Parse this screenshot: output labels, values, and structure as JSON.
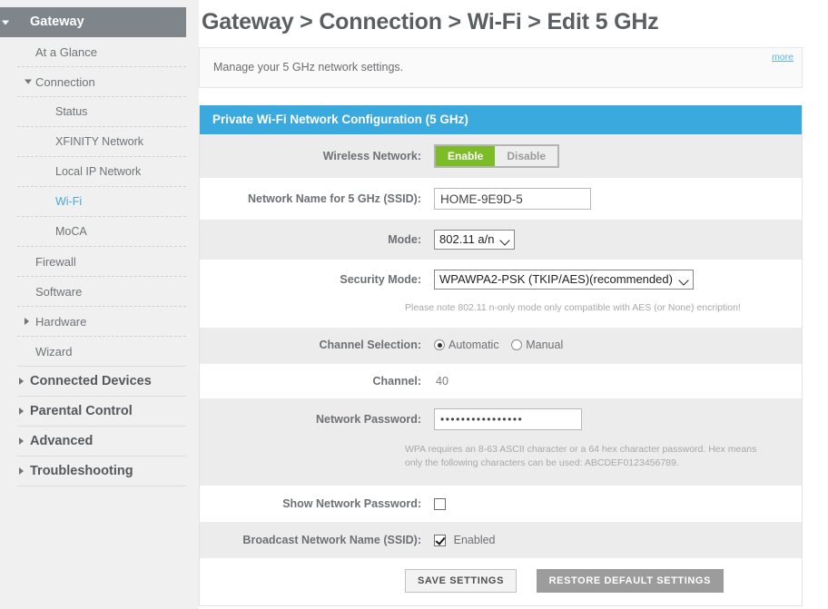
{
  "sidebar": {
    "items": [
      {
        "label": "Gateway",
        "level": "header",
        "caret": "down",
        "active": true
      },
      {
        "label": "At a Glance",
        "level": "lvl1",
        "caret": "none",
        "active": false
      },
      {
        "label": "Connection",
        "level": "lvl1",
        "caret": "down",
        "active": false
      },
      {
        "label": "Status",
        "level": "lvl2",
        "caret": "none",
        "active": false
      },
      {
        "label": "XFINITY Network",
        "level": "lvl2",
        "caret": "none",
        "active": false
      },
      {
        "label": "Local IP Network",
        "level": "lvl2",
        "caret": "none",
        "active": false
      },
      {
        "label": "Wi-Fi",
        "level": "lvl2",
        "caret": "none",
        "active": true
      },
      {
        "label": "MoCA",
        "level": "lvl2",
        "caret": "none",
        "active": false
      },
      {
        "label": "Firewall",
        "level": "lvl1",
        "caret": "none",
        "active": false
      },
      {
        "label": "Software",
        "level": "lvl1",
        "caret": "none",
        "active": false
      },
      {
        "label": "Hardware",
        "level": "lvl1",
        "caret": "right",
        "active": false
      },
      {
        "label": "Wizard",
        "level": "lvl1",
        "caret": "none",
        "active": false
      },
      {
        "label": "Connected Devices",
        "level": "group",
        "caret": "right",
        "active": false
      },
      {
        "label": "Parental Control",
        "level": "group",
        "caret": "right",
        "active": false
      },
      {
        "label": "Advanced",
        "level": "group",
        "caret": "right",
        "active": false
      },
      {
        "label": "Troubleshooting",
        "level": "group",
        "caret": "right",
        "active": false
      }
    ]
  },
  "main": {
    "breadcrumb": "Gateway > Connection > Wi-Fi > Edit 5 GHz",
    "info": {
      "text": "Manage your 5 GHz network settings.",
      "more_label": "more"
    },
    "card": {
      "header": "Private Wi-Fi Network Configuration (5 GHz)",
      "rows": {
        "wireless_network": {
          "label": "Wireless Network:",
          "enable_label": "Enable",
          "disable_label": "Disable",
          "selected": "Enable"
        },
        "ssid": {
          "label": "Network Name for 5 GHz (SSID):",
          "value": "HOME-9E9D-5"
        },
        "mode": {
          "label": "Mode:",
          "value": "802.11 a/n"
        },
        "security_mode": {
          "label": "Security Mode:",
          "value": "WPAWPA2-PSK (TKIP/AES)(recommended)",
          "note": "Please note 802.11 n-only mode only compatible with AES (or None) encription!"
        },
        "channel_selection": {
          "label": "Channel Selection:",
          "automatic_label": "Automatic",
          "manual_label": "Manual",
          "selected": "Automatic"
        },
        "channel": {
          "label": "Channel:",
          "value": "40"
        },
        "network_password": {
          "label": "Network Password:",
          "value": "••••••••••••••••",
          "note": "WPA requires an 8-63 ASCII character or a 64 hex character password. Hex means only the following characters can be used: ABCDEF0123456789."
        },
        "show_password": {
          "label": "Show Network Password:",
          "checked": false
        },
        "broadcast_ssid": {
          "label": "Broadcast Network Name (SSID):",
          "checkbox_label": "Enabled",
          "checked": true
        }
      },
      "buttons": {
        "save": "SAVE SETTINGS",
        "restore": "RESTORE DEFAULT SETTINGS"
      }
    }
  },
  "colors": {
    "accent_blue": "#3aa9de",
    "enable_green": "#7cbc27",
    "sidebar_header_gray": "#7e868b",
    "link_blue": "#4aa9dd",
    "page_bg": "#f0f0f0"
  }
}
